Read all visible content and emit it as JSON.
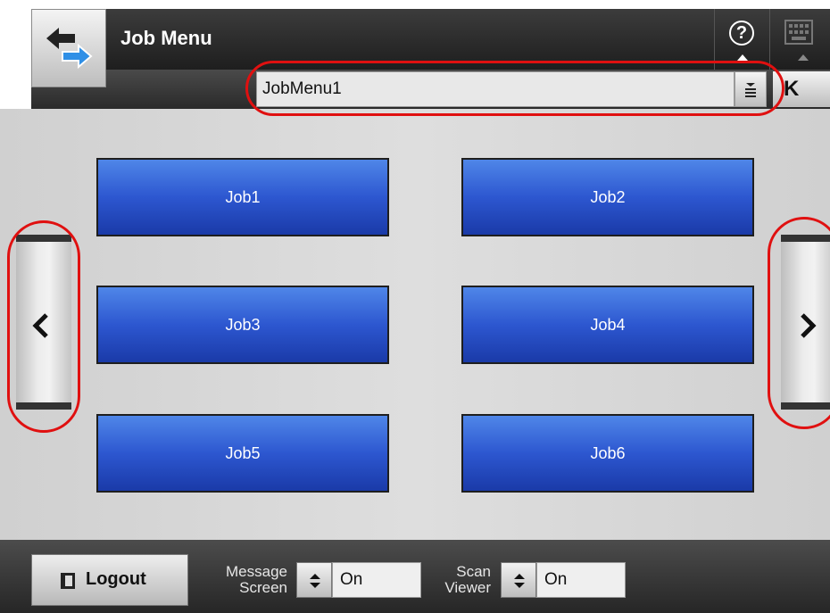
{
  "header": {
    "title": "Job Menu",
    "help_glyph": "?",
    "icons": [
      "back-arrow-icon",
      "help-icon",
      "keyboard-icon"
    ]
  },
  "menu_selector": {
    "value": "JobMenu1",
    "collapse_glyph": "K"
  },
  "jobs": [
    {
      "label": "Job1"
    },
    {
      "label": "Job2"
    },
    {
      "label": "Job3"
    },
    {
      "label": "Job4"
    },
    {
      "label": "Job5"
    },
    {
      "label": "Job6"
    }
  ],
  "pager": {
    "prev_icon": "chevron-left-icon",
    "next_icon": "chevron-right-icon"
  },
  "footer": {
    "logout_label": "Logout",
    "message_screen": {
      "label_line1": "Message",
      "label_line2": "Screen",
      "value": "On"
    },
    "scan_viewer": {
      "label_line1": "Scan",
      "label_line2": "Viewer",
      "value": "On"
    }
  },
  "colors": {
    "job_button": "#2d57d0",
    "highlight_ring": "#e01010",
    "header_bg": "#2a2a2a"
  }
}
